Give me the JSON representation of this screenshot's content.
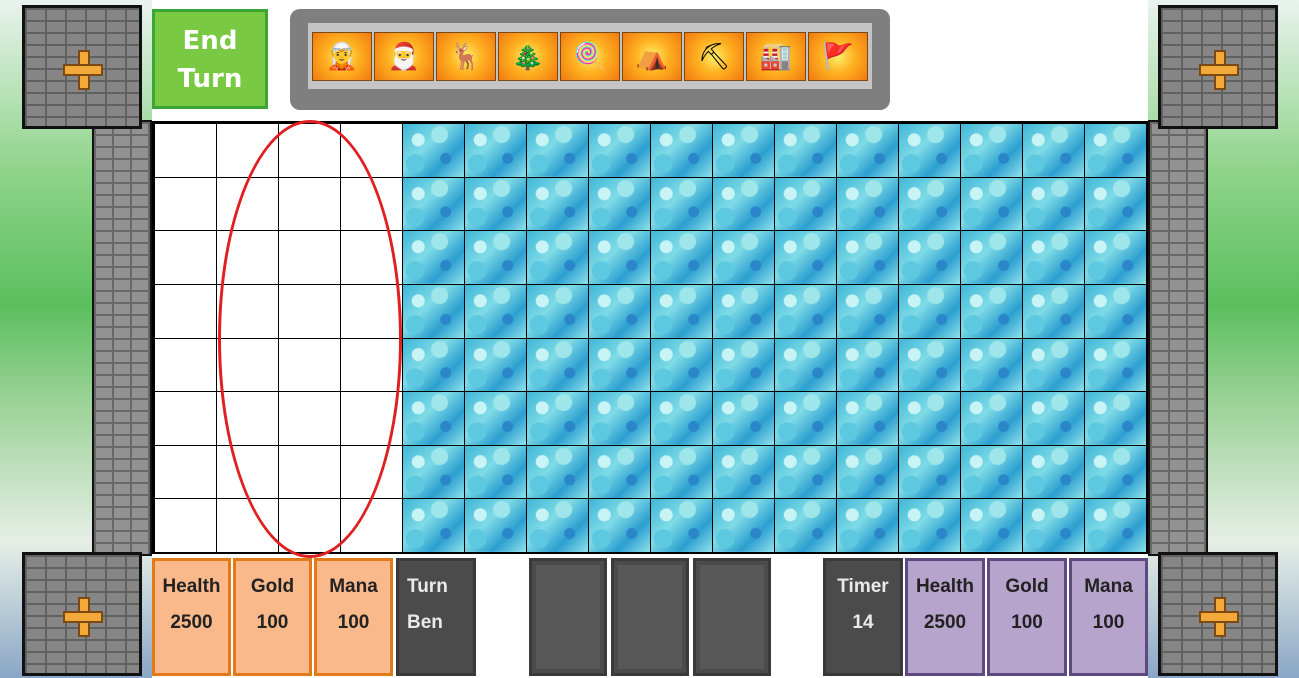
{
  "end_turn": {
    "line1": "End",
    "line2": "Turn"
  },
  "cards": [
    {
      "icon": "elf-icon",
      "glyph": "🧝"
    },
    {
      "icon": "santa-icon",
      "glyph": "🎅"
    },
    {
      "icon": "reindeer-icon",
      "glyph": "🦌"
    },
    {
      "icon": "trees-icon",
      "glyph": "🎄"
    },
    {
      "icon": "candy-cane-icon",
      "glyph": "🍭"
    },
    {
      "icon": "igloo-icon",
      "glyph": "⛺"
    },
    {
      "icon": "mine-icon",
      "glyph": "⛏"
    },
    {
      "icon": "factory-icon",
      "glyph": "🏭"
    },
    {
      "icon": "north-pole-icon",
      "glyph": "🚩"
    }
  ],
  "board": {
    "rows": 8,
    "cols": 16,
    "white_cols": 4
  },
  "player": {
    "health_label": "Health",
    "health": "2500",
    "gold_label": "Gold",
    "gold": "100",
    "mana_label": "Mana",
    "mana": "100"
  },
  "turn": {
    "label": "Turn",
    "name": "Ben"
  },
  "timer": {
    "label": "Timer",
    "value": "14"
  },
  "opponent": {
    "health_label": "Health",
    "health": "2500",
    "gold_label": "Gold",
    "gold": "100",
    "mana_label": "Mana",
    "mana": "100"
  },
  "colors": {
    "end_turn": "#7ac943",
    "player": "#f9b98a",
    "opponent": "#b6a4cc",
    "highlight": "#e02020"
  }
}
